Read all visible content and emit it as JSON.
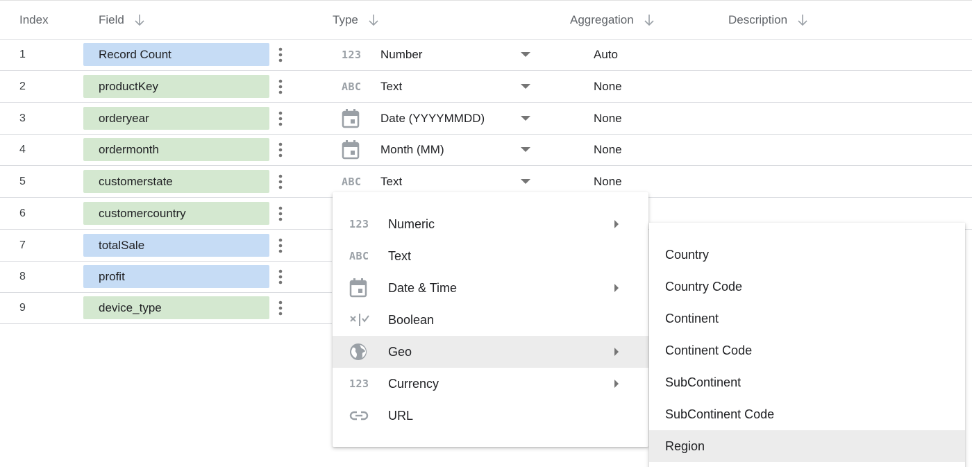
{
  "colors": {
    "metric_chip": "#c6dcf5",
    "dimension_chip": "#d4e8d0",
    "menu_hover": "#ececec",
    "icon_gray": "#9aa0a6"
  },
  "columns": {
    "index": "Index",
    "field": "Field",
    "type": "Type",
    "aggregation": "Aggregation",
    "description": "Description"
  },
  "rows": [
    {
      "index": "1",
      "field": "Record Count",
      "kind": "metric",
      "type_icon": "123",
      "type": "Number",
      "aggregation": "Auto"
    },
    {
      "index": "2",
      "field": "productKey",
      "kind": "dimension",
      "type_icon": "ABC",
      "type": "Text",
      "aggregation": "None"
    },
    {
      "index": "3",
      "field": "orderyear",
      "kind": "dimension",
      "type_icon": "calendar-icon",
      "type": "Date (YYYYMMDD)",
      "aggregation": "None"
    },
    {
      "index": "4",
      "field": "ordermonth",
      "kind": "dimension",
      "type_icon": "calendar-icon",
      "type": "Month (MM)",
      "aggregation": "None"
    },
    {
      "index": "5",
      "field": "customerstate",
      "kind": "dimension",
      "type_icon": "ABC",
      "type": "Text",
      "aggregation": "None"
    },
    {
      "index": "6",
      "field": "customercountry",
      "kind": "dimension"
    },
    {
      "index": "7",
      "field": "totalSale",
      "kind": "metric"
    },
    {
      "index": "8",
      "field": "profit",
      "kind": "metric"
    },
    {
      "index": "9",
      "field": "device_type",
      "kind": "dimension"
    }
  ],
  "type_menu": {
    "items": [
      {
        "icon": "123",
        "label": "Numeric",
        "submenu": true
      },
      {
        "icon": "ABC",
        "label": "Text",
        "submenu": false
      },
      {
        "icon": "calendar-icon",
        "label": "Date & Time",
        "submenu": true
      },
      {
        "icon": "boolean-icon",
        "label": "Boolean",
        "submenu": false
      },
      {
        "icon": "globe-icon",
        "label": "Geo",
        "submenu": true,
        "active": true
      },
      {
        "icon": "123",
        "label": "Currency",
        "submenu": true
      },
      {
        "icon": "link-icon",
        "label": "URL",
        "submenu": false
      }
    ]
  },
  "geo_submenu": {
    "items": [
      {
        "label": "Country"
      },
      {
        "label": "Country Code"
      },
      {
        "label": "Continent"
      },
      {
        "label": "Continent Code"
      },
      {
        "label": "SubContinent"
      },
      {
        "label": "SubContinent Code"
      },
      {
        "label": "Region",
        "active": true
      }
    ]
  }
}
